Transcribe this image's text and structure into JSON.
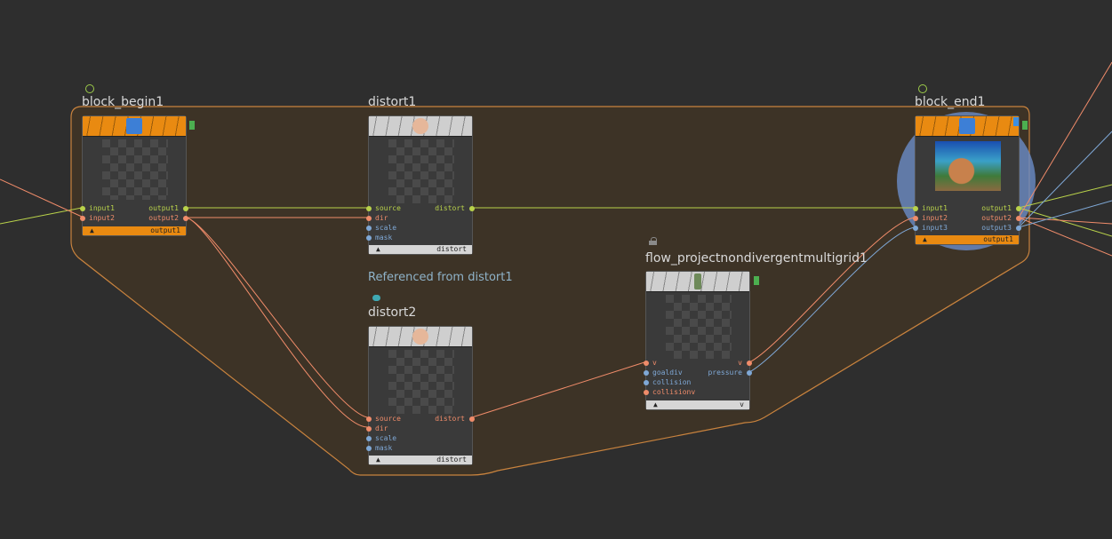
{
  "nodes": {
    "block_begin": {
      "title": "block_begin1",
      "inputs": [
        "input1",
        "input2"
      ],
      "outputs": [
        "output1",
        "output2"
      ],
      "footer": "output1"
    },
    "distort1": {
      "title": "distort1",
      "inputs": [
        "source",
        "dir",
        "scale",
        "mask"
      ],
      "outputs": [
        "distort"
      ],
      "footer": "distort"
    },
    "distort2": {
      "title": "distort2",
      "inputs": [
        "source",
        "dir",
        "scale",
        "mask"
      ],
      "outputs": [
        "distort"
      ],
      "footer": "distort"
    },
    "flow": {
      "title": "flow_projectnondivergentmultigrid1",
      "inputs": [
        "v",
        "goaldiv",
        "collision",
        "collisionv"
      ],
      "outputs": [
        "v",
        "pressure"
      ],
      "footer": "v"
    },
    "block_end": {
      "title": "block_end1",
      "inputs": [
        "input1",
        "input2",
        "input3"
      ],
      "outputs": [
        "output1",
        "output2",
        "output3"
      ],
      "footer": "output1"
    }
  },
  "comment": "Referenced from distort1",
  "footer_triangle": "▲",
  "colors": {
    "background": "#2e2e2e",
    "block_region": "#3d3326",
    "block_border": "#c9833e",
    "wire_yellow": "#b9d24a",
    "wire_orange": "#f08c6a",
    "wire_blue": "#7fa8d6",
    "node_orange": "#e98a11",
    "selection_blue": "#6a8cc8"
  },
  "icons": {
    "block_begin": "cube-icon",
    "distort": "face-icon",
    "flow": "figure-icon",
    "block_end": "cube-icon",
    "lock": "lock-icon",
    "comment": "speech-bubble-icon"
  }
}
